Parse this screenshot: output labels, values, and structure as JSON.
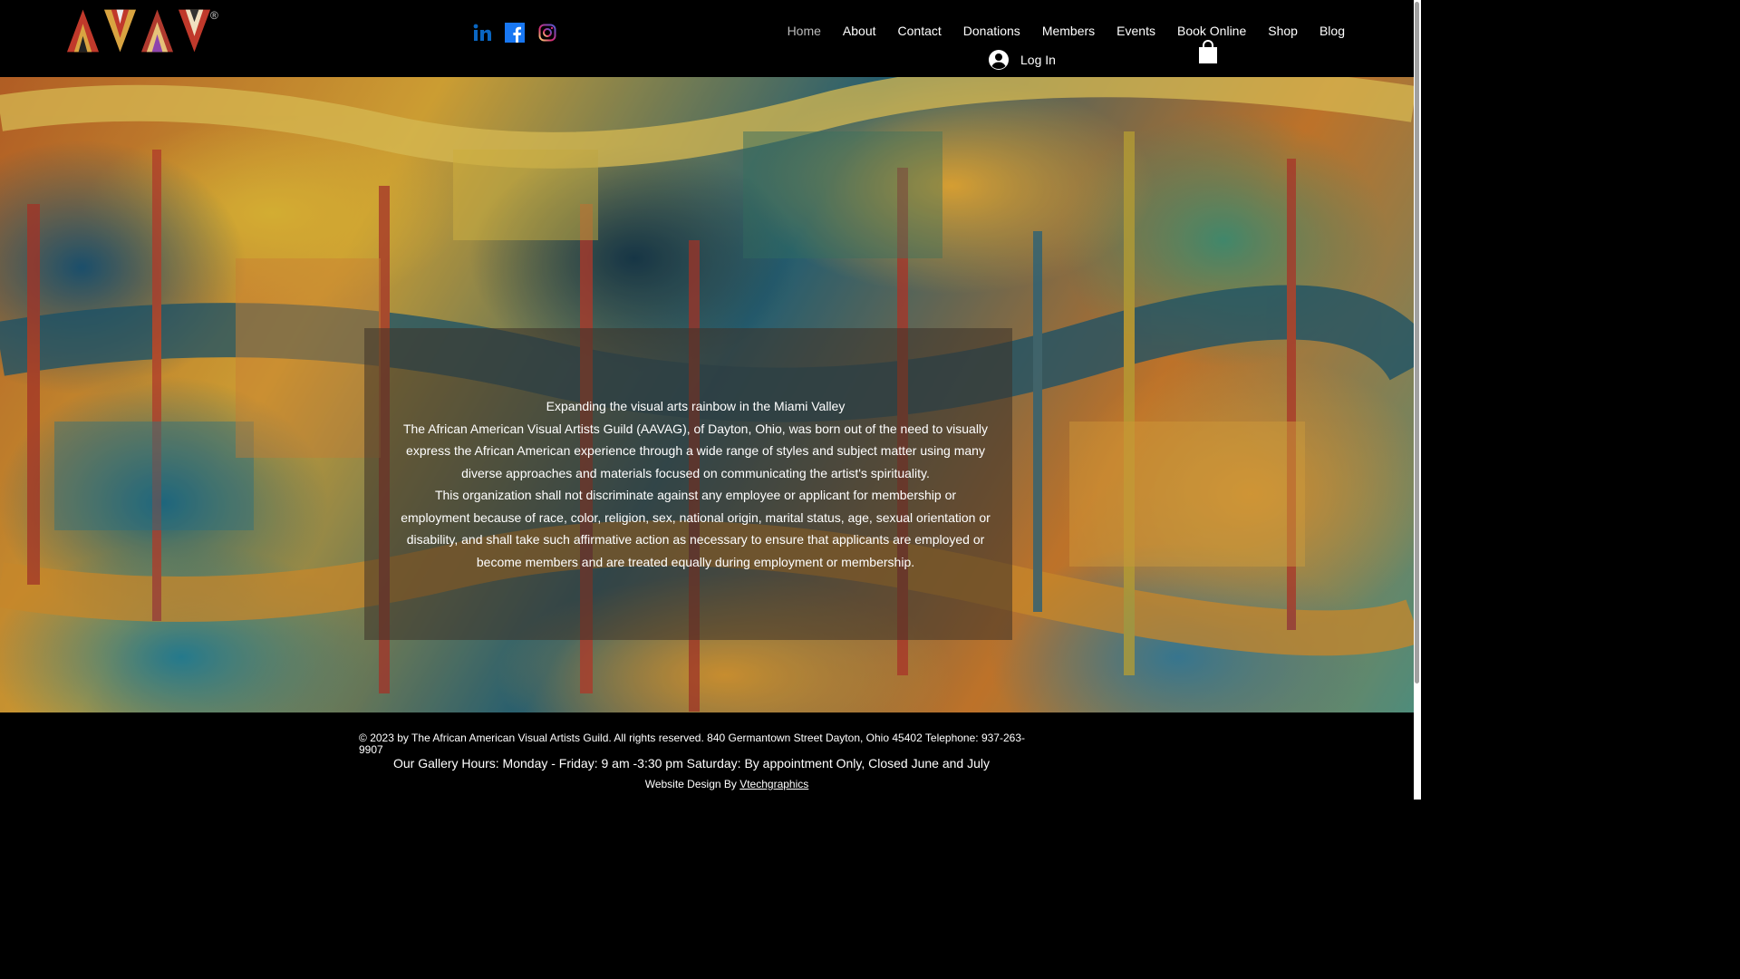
{
  "header": {
    "logo_alt": "AAVAG",
    "registered_mark": "®",
    "social": [
      {
        "name": "linkedin-icon",
        "label": "LinkedIn"
      },
      {
        "name": "facebook-icon",
        "label": "Facebook"
      },
      {
        "name": "instagram-icon",
        "label": "Instagram"
      }
    ],
    "nav": [
      {
        "label": "Home",
        "active": true
      },
      {
        "label": "About"
      },
      {
        "label": "Contact"
      },
      {
        "label": "Donations"
      },
      {
        "label": "Members"
      },
      {
        "label": "Events"
      },
      {
        "label": "Book Online"
      },
      {
        "label": "Shop"
      },
      {
        "label": "Blog"
      }
    ],
    "login_label": "Log In"
  },
  "hero": {
    "paragraphs": [
      "Expanding the visual arts rainbow in the Miami Valley",
      "The African American Visual Artists Guild (AAVAG), of Dayton, Ohio, was born out of the need to visually express the African American experience through a wide range of styles and subject matter using many diverse approaches and materials focused on communicating the artist's spirituality.",
      "This organization shall not discriminate against any employee or applicant for membership or employment because of race, color, religion, sex, national origin, marital status, age, sexual orientation or disability, and shall take such affirmative action as necessary to ensure that applicants are employed or become members and are treated equally during employment or membership."
    ]
  },
  "footer": {
    "copyright": "© 2023 by The African American Visual Artists Guild. All rights reserved. 840 Germantown Street Dayton, Ohio 45402 Telephone: 937-263-9907",
    "hours": "Our Gallery Hours: Monday - Friday: 9 am -3:30 pm Saturday: By appointment Only, Closed June and July",
    "design_prefix": "Website Design By ",
    "design_link": "Vtechgraphics "
  },
  "colors": {
    "linkedin": "#0a66c2",
    "facebook": "#1877f2",
    "instagram": "#e1306c",
    "logo_red": "#c0392b",
    "logo_gold": "#d9a441"
  }
}
